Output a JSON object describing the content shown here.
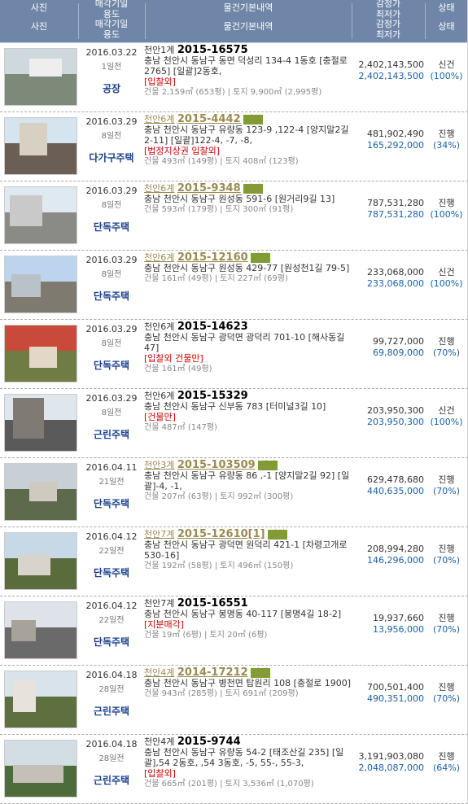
{
  "header": {
    "photo_top": "사진",
    "photo_bottom": "사진",
    "date_top": "매각기일\n용도",
    "date_bottom": "매각기일\n용도",
    "info_top": "물건기본내역",
    "info_bottom": "물건기본내역",
    "price_top": "감정가\n최저가",
    "price_bottom": "감정가\n최저가",
    "status_top": "상태",
    "status_bottom": "상태"
  },
  "rows": [
    {
      "date": "2016.03.22",
      "ago": "1일전",
      "type": "공장",
      "court": "천안1계",
      "case_no": "2015-16575",
      "interest": false,
      "badge": "",
      "address": "충남 천안시 동남구 동면 덕성리 134-4 1동호 [충절로 2765] [일괄]2동호,",
      "tags": "[입찰외]",
      "area": "건물 2,159㎡ (653평) | 토지 9,900㎡ (2,995평)",
      "appraisal": "2,402,143,500",
      "minimum": "2,402,143,500",
      "status": "신건",
      "percent": "(100%)"
    },
    {
      "date": "2016.03.29",
      "ago": "8일전",
      "type": "다가구주택",
      "court": "천안6계",
      "case_no": "2015-4442",
      "interest": true,
      "badge": "관심",
      "address": "충남 천안시 동남구 유량동 123-9 ,122-4 [양지말2길 2-11] [일괄]122-4, -7, -8,",
      "tags": "[법정지상권  입찰외]",
      "area": "건물 493㎡ (149평) | 토지 408㎡ (123평)",
      "appraisal": "481,902,490",
      "minimum": "165,292,000",
      "status": "진행",
      "percent": "(34%)"
    },
    {
      "date": "2016.03.29",
      "ago": "8일전",
      "type": "단독주택",
      "court": "천안6계",
      "case_no": "2015-9348",
      "interest": true,
      "badge": "관심",
      "address": "충남 천안시 동남구 원성동 591-6 [원거리9길 13]",
      "tags": "",
      "area": "건물 593㎡ (179평) | 토지 300㎡ (91평)",
      "appraisal": "787,531,280",
      "minimum": "787,531,280",
      "status": "진행",
      "percent": "(100%)"
    },
    {
      "date": "2016.03.29",
      "ago": "8일전",
      "type": "단독주택",
      "court": "천안6계",
      "case_no": "2015-12160",
      "interest": true,
      "badge": "관심",
      "address": "충남 천안시 동남구 원성동 429-77 [원성천1길 79-5]",
      "tags": "",
      "area": "건물 161㎡ (49평) | 토지 227㎡ (69평)",
      "appraisal": "233,068,000",
      "minimum": "233,068,000",
      "status": "신건",
      "percent": "(100%)"
    },
    {
      "date": "2016.03.29",
      "ago": "8일전",
      "type": "단독주택",
      "court": "천안6계",
      "case_no": "2015-14623",
      "interest": false,
      "badge": "",
      "address": "충남 천안시 동남구 광덕면 광덕리 701-10 [해사동길 47]",
      "tags": "[입찰외  건물만]",
      "area": "건물 161㎡ (49평)",
      "appraisal": "99,727,000",
      "minimum": "69,809,000",
      "status": "진행",
      "percent": "(70%)"
    },
    {
      "date": "2016.03.29",
      "ago": "8일전",
      "type": "근린주택",
      "court": "천안6계",
      "case_no": "2015-15329",
      "interest": false,
      "badge": "",
      "address": "충남 천안시 동남구 신부동 783 [터미널3길 10]",
      "tags": "[건물만]",
      "area": "건물 487㎡ (147평)",
      "appraisal": "203,950,300",
      "minimum": "203,950,300",
      "status": "신건",
      "percent": "(100%)"
    },
    {
      "date": "2016.04.11",
      "ago": "21일전",
      "type": "단독주택",
      "court": "천안3계",
      "case_no": "2015-103509",
      "interest": true,
      "badge": "관심",
      "address": "충남 천안시 동남구 유량동 86 ,-1 [양지말2길 92] [일괄]-4, -1,",
      "tags": "",
      "area": "건물 207㎡ (63평) | 토지 992㎡ (300평)",
      "appraisal": "629,478,680",
      "minimum": "440,635,000",
      "status": "진행",
      "percent": "(70%)"
    },
    {
      "date": "2016.04.12",
      "ago": "22일전",
      "type": "단독주택",
      "court": "천안7계",
      "case_no": "2015-12610[1]",
      "interest": true,
      "badge": "관심",
      "address": "충남 천안시 동남구 광덕면 원덕리 421-1 [차령고개로 530-16]",
      "tags": "",
      "area": "건물 192㎡ (58평) | 토지 496㎡ (150평)",
      "appraisal": "208,994,280",
      "minimum": "146,296,000",
      "status": "진행",
      "percent": "(70%)"
    },
    {
      "date": "2016.04.12",
      "ago": "22일전",
      "type": "단독주택",
      "court": "천안7계",
      "case_no": "2015-16551",
      "interest": false,
      "badge": "",
      "address": "충남 천안시 동남구 봉명동 40-117 [봉명4길 18-2]",
      "tags": "[지분매각]",
      "area": "건물 19㎡ (6평) | 토지 20㎡ (6평)",
      "appraisal": "19,937,660",
      "minimum": "13,956,000",
      "status": "진행",
      "percent": "(70%)"
    },
    {
      "date": "2016.04.18",
      "ago": "28일전",
      "type": "근린주택",
      "court": "천안4계",
      "case_no": "2014-17212",
      "interest": true,
      "badge": "관심",
      "address": "충남 천안시 동남구 병천면 탑원리 108 [충절로 1900]",
      "tags": "",
      "area": "건물 943㎡ (285평) | 토지 691㎡ (209평)",
      "appraisal": "700,501,400",
      "minimum": "490,351,000",
      "status": "진행",
      "percent": "(70%)"
    },
    {
      "date": "2016.04.18",
      "ago": "28일전",
      "type": "근린주택",
      "court": "천안4계",
      "case_no": "2015-9744",
      "interest": false,
      "badge": "",
      "address": "충남 천안시 동남구 유량동 54-2 [태조산길 235] [일괄],54 2동호, ,54 3동호, -5, 55-, 55-3,",
      "tags": "[입찰외]",
      "area": "건물 665㎡ (201평) | 토지 3,536㎡ (1,070평)",
      "appraisal": "3,191,903,080",
      "minimum": "2,048,087,000",
      "status": "진행",
      "percent": "(64%)"
    }
  ]
}
